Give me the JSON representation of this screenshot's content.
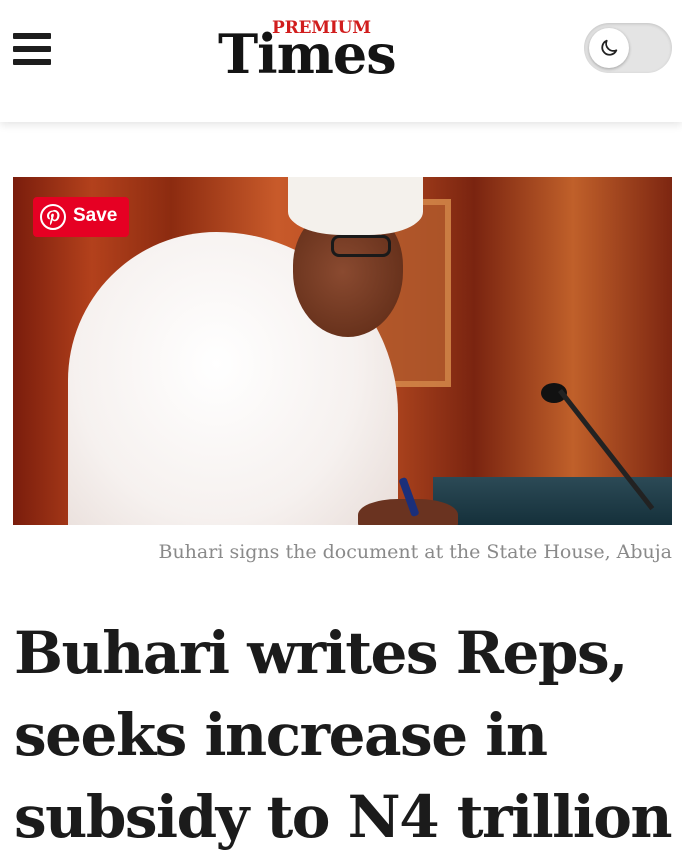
{
  "header": {
    "logo_premium": "PREMIUM",
    "logo_times": "Times",
    "menu_icon": "hamburger-menu-icon",
    "theme_toggle_icon": "moon-icon",
    "brand_red": "#d11d1d"
  },
  "image": {
    "save_label": "Save",
    "save_icon": "pinterest-icon",
    "save_color": "#e60023",
    "caption": "Buhari signs the document at the State House, Abuja"
  },
  "article": {
    "headline": "Buhari writes Reps, seeks increase in subsidy to N4 trillion"
  }
}
